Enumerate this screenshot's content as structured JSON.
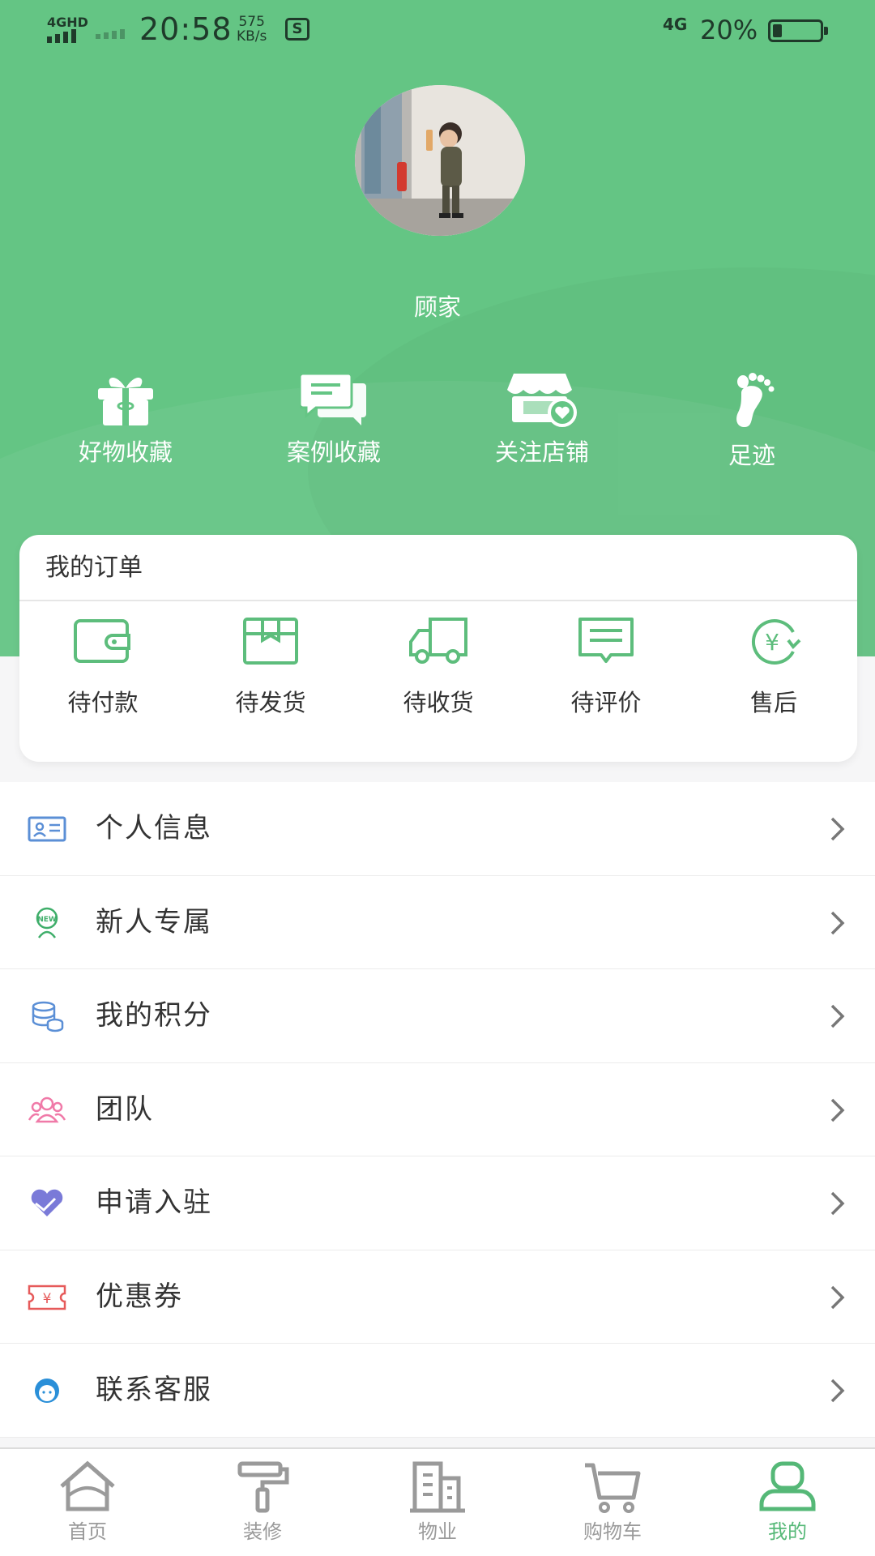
{
  "status_bar": {
    "network_type": "4GHD",
    "time": "20:58",
    "speed_value": "575",
    "speed_unit": "KB/s",
    "mobile_data": "4G",
    "battery_percent_text": "20%",
    "battery_level": 0.2
  },
  "profile": {
    "username": "顾家"
  },
  "quick_links": [
    {
      "label": "好物收藏",
      "icon": "gift-icon"
    },
    {
      "label": "案例收藏",
      "icon": "chat-bubbles-icon"
    },
    {
      "label": "关注店铺",
      "icon": "store-heart-icon"
    },
    {
      "label": "足迹",
      "icon": "footprint-icon"
    }
  ],
  "orders": {
    "title": "我的订单",
    "items": [
      {
        "label": "待付款",
        "icon": "wallet-icon"
      },
      {
        "label": "待发货",
        "icon": "package-icon"
      },
      {
        "label": "待收货",
        "icon": "truck-icon"
      },
      {
        "label": "待评价",
        "icon": "comment-icon"
      },
      {
        "label": "售后",
        "icon": "yuan-refund-icon"
      }
    ]
  },
  "menu": [
    {
      "label": "个人信息",
      "icon": "id-card-icon"
    },
    {
      "label": "新人专属",
      "icon": "new-user-icon"
    },
    {
      "label": "我的积分",
      "icon": "coins-icon"
    },
    {
      "label": "团队",
      "icon": "team-icon"
    },
    {
      "label": "申请入驻",
      "icon": "handshake-heart-icon"
    },
    {
      "label": "优惠券",
      "icon": "coupon-icon"
    },
    {
      "label": "联系客服",
      "icon": "customer-service-icon"
    }
  ],
  "tabbar": {
    "active": "我的",
    "tabs": [
      {
        "label": "首页",
        "icon": "home-icon"
      },
      {
        "label": "装修",
        "icon": "paint-roller-icon"
      },
      {
        "label": "物业",
        "icon": "building-icon"
      },
      {
        "label": "购物车",
        "icon": "cart-icon"
      },
      {
        "label": "我的",
        "icon": "user-icon"
      }
    ]
  },
  "colors": {
    "brand_green": "#64c584",
    "accent_green": "#55b877",
    "tab_inactive": "#9a9a9a",
    "blue_icon": "#5b8fd6",
    "pink_icon": "#f07aa8",
    "purple_icon": "#7a7ad8",
    "red_icon": "#e65a5a"
  }
}
